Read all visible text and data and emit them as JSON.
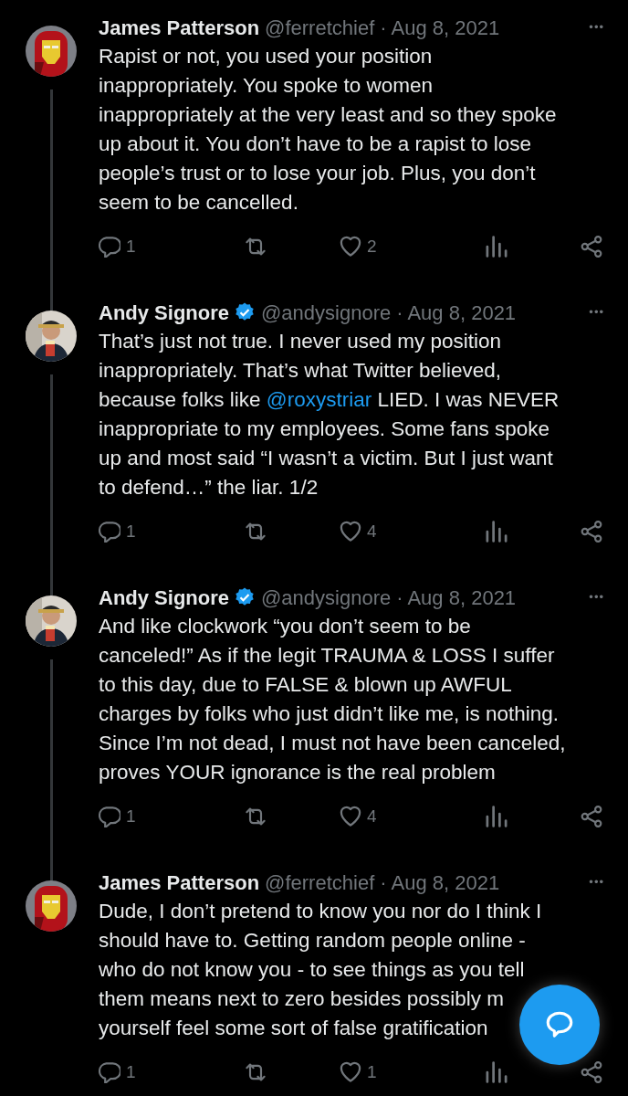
{
  "tweets": [
    {
      "name": "James Patterson",
      "verified": false,
      "handle": "@ferretchief",
      "date": "· Aug 8, 2021",
      "more": "•••",
      "thread_line": true,
      "avatar": {
        "kind": "picture"
      },
      "body": [
        {
          "kind": "text",
          "text": "Rapist or not, you used your position\ninappropriately. You spoke to women\ninappropriately at the very least and so they spoke\nup about it. You don’t have to be a rapist to lose\npeople’s trust or to lose your job. Plus, you don’t\nseem to be cancelled."
        }
      ],
      "replies": "1",
      "likes": "2"
    },
    {
      "name": "Andy Signore",
      "verified": true,
      "handle": "@andysignore",
      "date": "· Aug 8, 2021",
      "more": "•••",
      "thread_line": true,
      "avatar": {
        "kind": "picture"
      },
      "body": [
        {
          "kind": "text",
          "text": "That’s just not true. I never used my position\ninappropriately. That’s what Twitter believed,\nbecause folks like "
        },
        {
          "kind": "mention",
          "text": "@roxystriar"
        },
        {
          "kind": "text",
          "text": " LIED. I was NEVER\ninappropriate to my employees. Some fans spoke\nup and most said “I wasn’t a victim. But I just want\nto defend…” the liar. 1/2"
        }
      ],
      "replies": "1",
      "likes": "4"
    },
    {
      "name": "Andy Signore",
      "verified": true,
      "handle": "@andysignore",
      "date": "· Aug 8, 2021",
      "more": "•••",
      "thread_line": true,
      "avatar": {
        "kind": "picture"
      },
      "body": [
        {
          "kind": "text",
          "text": "And like clockwork “you don’t seem to be\ncanceled!” As if the legit TRAUMA & LOSS I suffer\nto this day, due to FALSE & blown up AWFUL\ncharges by folks who just didn’t like me, is nothing.\nSince I’m not dead, I must not have been canceled,\nproves YOUR ignorance is the real problem"
        }
      ],
      "replies": "1",
      "likes": "4"
    },
    {
      "name": "James Patterson",
      "verified": false,
      "handle": "@ferretchief",
      "date": "· Aug 8, 2021",
      "more": "•••",
      "thread_line": false,
      "avatar": {
        "kind": "picture"
      },
      "body": [
        {
          "kind": "block",
          "text": "Dude, I don’t pretend to know you nor do I think I\nshould have to. Getting random people online -\nwho do not know you - to see things as you tell"
        },
        {
          "kind": "block",
          "text": "them means next to zero besides possibly m\nyourself feel some sort of false gratification"
        }
      ],
      "replies": "1",
      "likes": "1"
    }
  ]
}
